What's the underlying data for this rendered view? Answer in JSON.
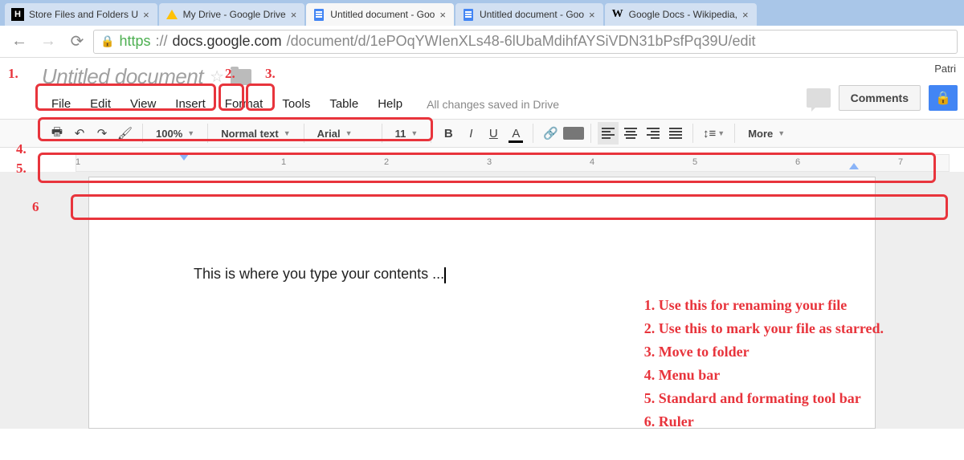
{
  "browser": {
    "tabs": [
      {
        "title": "Store Files and Folders U",
        "favicon": "h"
      },
      {
        "title": "My Drive - Google Drive",
        "favicon": "drive"
      },
      {
        "title": "Untitled document - Goo",
        "favicon": "docs",
        "active": true
      },
      {
        "title": "Untitled document - Goo",
        "favicon": "docs"
      },
      {
        "title": "Google Docs - Wikipedia,",
        "favicon": "wiki"
      }
    ],
    "url": {
      "https": "https",
      "sep": "://",
      "domain": "docs.google.com",
      "path": "/document/d/1ePOqYWIenXLs48-6lUbaMdihfAYSiVDN31bPsfPq39U/edit"
    }
  },
  "docs": {
    "user": "Patri",
    "title": "Untitled document",
    "comments": "Comments",
    "save_status": "All changes saved in Drive",
    "menu": [
      "File",
      "Edit",
      "View",
      "Insert",
      "Format",
      "Tools",
      "Table",
      "Help"
    ],
    "toolbar": {
      "zoom": "100%",
      "style": "Normal text",
      "font": "Arial",
      "size": "11",
      "more": "More"
    }
  },
  "page": {
    "text": "This is where you type your contents ..."
  },
  "ruler": {
    "numbers": [
      "1",
      "1",
      "2",
      "3",
      "4",
      "5",
      "6",
      "7"
    ]
  },
  "annotations": {
    "n1": "1.",
    "n2": "2.",
    "n3": "3.",
    "n4": "4.",
    "n5": "5.",
    "n6": "6",
    "legend": [
      "1.  Use this for renaming your file",
      "2.  Use this to mark your file as starred.",
      "3.  Move to folder",
      "4.  Menu bar",
      "5.  Standard and formating tool bar",
      "6.  Ruler"
    ]
  }
}
